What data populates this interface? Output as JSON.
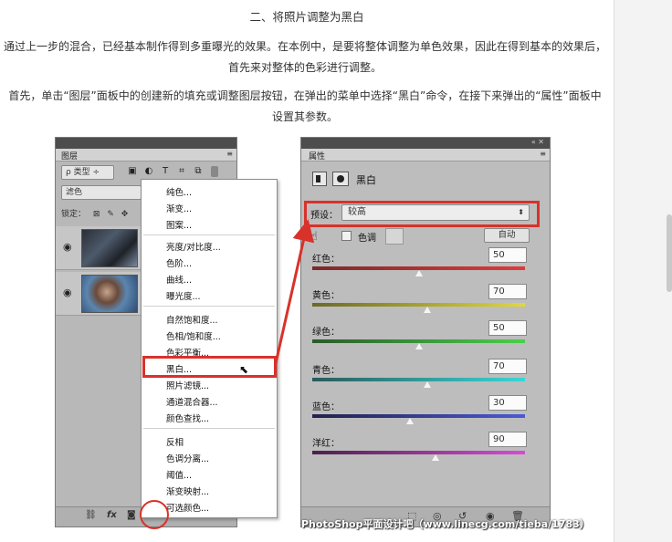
{
  "article": {
    "heading": "二、将照片调整为黑白",
    "para1": "通过上一步的混合，已经基本制作得到多重曝光的效果。在本例中，是要将整体调整为单色效果，因此在得到基本的效果后，首先来对整体的色彩进行调整。",
    "para2": "首先，单击“图层”面板中的创建新的填充或调整图层按钮，在弹出的菜单中选择“黑白”命令，在接下来弹出的“属性”面板中设置其参数。"
  },
  "layers_panel": {
    "tab": "图层",
    "menu_icon": "≡",
    "filter_label": "ρ 类型",
    "filter_arrow": "÷",
    "blend_mode": "滤色",
    "lock_label": "锁定：",
    "bottom_icons": [
      "link-icon",
      "fx-icon",
      "mask-icon"
    ]
  },
  "menu": {
    "items": [
      "纯色...",
      "渐变...",
      "图案...",
      "亮度/对比度...",
      "色阶...",
      "曲线...",
      "曝光度...",
      "自然饱和度...",
      "色相/饱和度...",
      "色彩平衡...",
      "黑白...",
      "照片滤镜...",
      "通道混合器...",
      "颜色查找...",
      "反相",
      "色调分离...",
      "阈值...",
      "渐变映射...",
      "可选颜色..."
    ]
  },
  "properties_panel": {
    "tab": "属性",
    "menu_icon": "≡",
    "title": "黑白",
    "preset_label": "预设：",
    "preset_value": "较高",
    "tint_label": "色调",
    "auto_button": "自动",
    "sliders": [
      {
        "label": "红色：",
        "value": "50",
        "min": -200,
        "max": 300,
        "colors": [
          "#7a2a2a",
          "#e03a3a"
        ]
      },
      {
        "label": "黄色：",
        "value": "70",
        "min": -200,
        "max": 300,
        "colors": [
          "#6a6a2a",
          "#e0d83a"
        ]
      },
      {
        "label": "绿色：",
        "value": "50",
        "min": -200,
        "max": 300,
        "colors": [
          "#2a5a2a",
          "#4ad04a"
        ]
      },
      {
        "label": "青色：",
        "value": "70",
        "min": -200,
        "max": 300,
        "colors": [
          "#2a5a5a",
          "#3ad6d6"
        ]
      },
      {
        "label": "蓝色：",
        "value": "30",
        "min": -200,
        "max": 300,
        "colors": [
          "#22224a",
          "#4a5ad8"
        ]
      },
      {
        "label": "洋红：",
        "value": "90",
        "min": -200,
        "max": 300,
        "colors": [
          "#4a224a",
          "#d84ad8"
        ]
      }
    ]
  },
  "watermark": "PhotoShop平面设计吧（www.linecg.com/tieba/1783）"
}
